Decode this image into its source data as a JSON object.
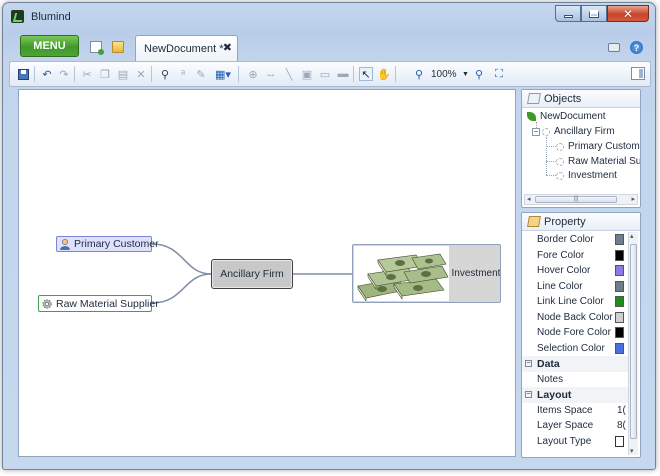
{
  "window": {
    "title": "Blumind"
  },
  "tabbar": {
    "menu_label": "MENU",
    "document_tab": "NewDocument *"
  },
  "toolbar": {
    "zoom": "100%"
  },
  "mindmap": {
    "center": "Ancillary Firm",
    "nodes": [
      {
        "label": "Primary Customer",
        "icon": "person-icon"
      },
      {
        "label": "Raw Material Supplier",
        "icon": "gear-icon"
      },
      {
        "label": "Investment",
        "icon": "money-image"
      }
    ]
  },
  "objects_panel": {
    "title": "Objects",
    "root": "NewDocument",
    "center": "Ancillary Firm",
    "children": [
      "Primary Custom",
      "Raw Material Su",
      "Investment"
    ]
  },
  "property_panel": {
    "title": "Property",
    "colors": [
      {
        "label": "Border Color",
        "color": "#6f7f8e"
      },
      {
        "label": "Fore Color",
        "color": "#000000"
      },
      {
        "label": "Hover Color",
        "color": "#8a7ce4"
      },
      {
        "label": "Line Color",
        "color": "#6d7f86"
      },
      {
        "label": "Link Line Color",
        "color": "#1a8f1a"
      },
      {
        "label": "Node Back Color",
        "color": "#cfcfcf"
      },
      {
        "label": "Node Fore Color",
        "color": "#000000"
      },
      {
        "label": "Selection Color",
        "color": "#4a6ee0"
      }
    ],
    "data_category": "Data",
    "notes_label": "Notes",
    "layout_category": "Layout",
    "layout_rows": [
      {
        "label": "Items Space",
        "value": "1("
      },
      {
        "label": "Layer Space",
        "value": "8("
      },
      {
        "label": "Layout Type",
        "value": ""
      }
    ]
  }
}
